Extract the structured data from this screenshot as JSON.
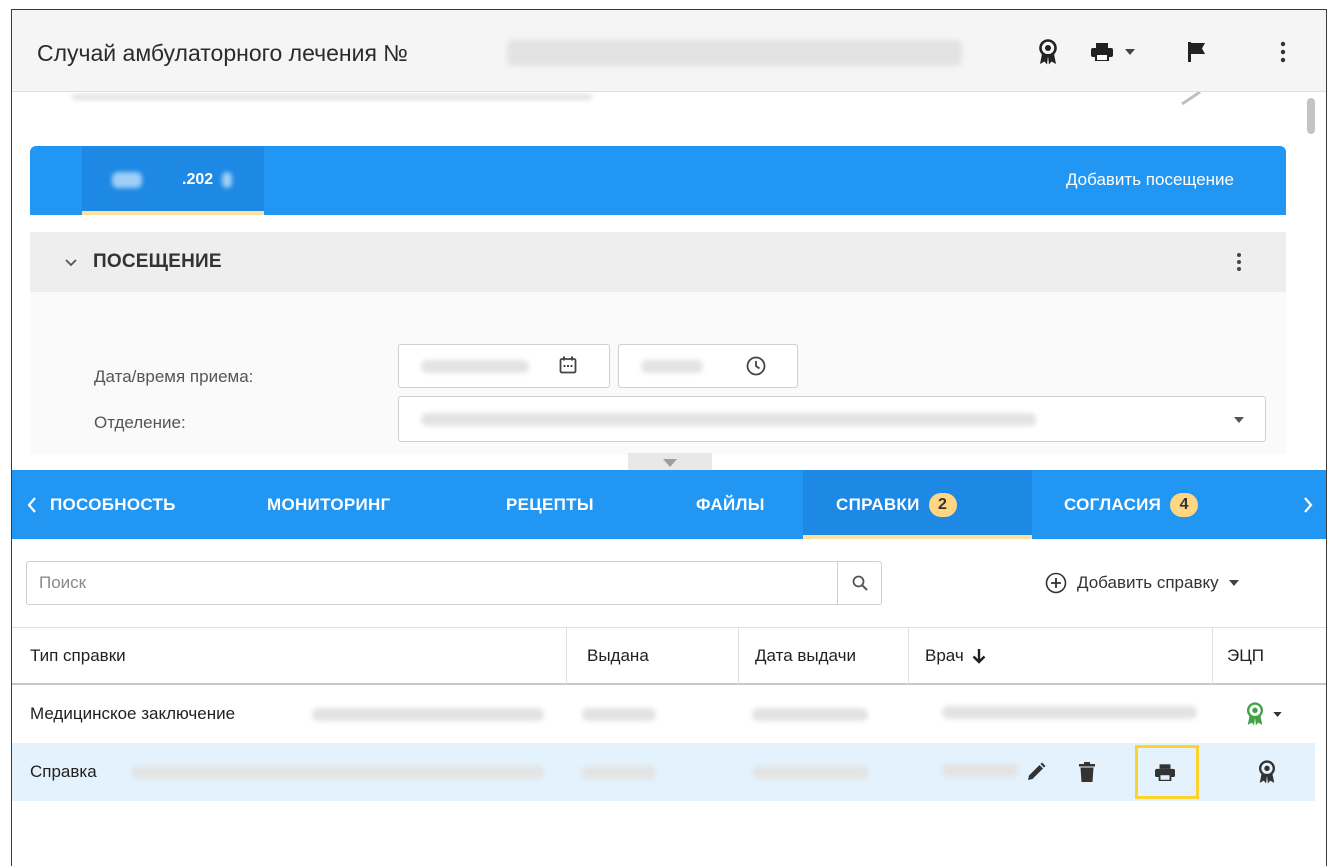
{
  "window": {
    "title": "Случай амбулаторного лечения №"
  },
  "visit": {
    "date_tab_label": ".202",
    "add_visit_label": "Добавить посещение",
    "section_title": "ПОСЕЩЕНИЕ",
    "fields": [
      {
        "label": "Дата/время приема:"
      },
      {
        "label": "Отделение:"
      }
    ]
  },
  "tabs": [
    {
      "label": "ПОСОБНОСТЬ",
      "active": false
    },
    {
      "label": "МОНИТОРИНГ",
      "active": false
    },
    {
      "label": "РЕЦЕПТЫ",
      "active": false
    },
    {
      "label": "ФАЙЛЫ",
      "active": false
    },
    {
      "label": "СПРАВКИ",
      "badge": "2",
      "active": true
    },
    {
      "label": "СОГЛАСИЯ",
      "badge": "4",
      "active": false
    }
  ],
  "search": {
    "placeholder": "Поиск"
  },
  "add_certificate_label": "Добавить справку",
  "table": {
    "columns": [
      "Тип справки",
      "Выдана",
      "Дата выдачи",
      "Врач",
      "ЭЦП"
    ],
    "sort_column": "Врач",
    "sort_direction": "desc",
    "rows": [
      {
        "type": "Медицинское заключение",
        "signed": true,
        "selected": false
      },
      {
        "type": "Справка",
        "signed": false,
        "selected": true
      }
    ]
  },
  "colors": {
    "primary": "#2196f3",
    "active_tab": "#1e88e5",
    "tab_underline": "#ffe0a3",
    "badge": "#ffd682",
    "selected_row": "#e3f2fd",
    "highlight": "#ffd22e",
    "signed_icon": "#43a047"
  },
  "icons": {
    "header": [
      "certificate-icon",
      "printer-icon",
      "flag-icon",
      "more-vert-icon"
    ],
    "row_actions": [
      "edit-icon",
      "delete-icon",
      "printer-icon"
    ]
  }
}
